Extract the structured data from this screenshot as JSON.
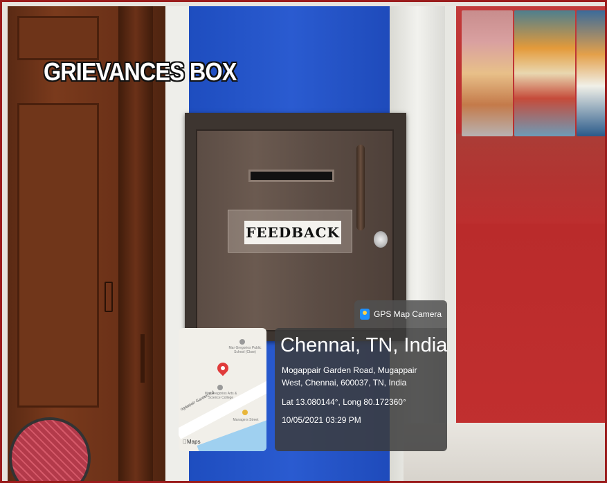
{
  "overlay_title": "GRIEVANCES BOX",
  "box_label": "FEEDBACK",
  "gps": {
    "app_name": "GPS Map Camera",
    "city": "Chennai, TN, India",
    "address": "Mogappair Garden Road, Mugappair West, Chennai, 600037, TN, India",
    "coordinates": "Lat 13.080144°, Long 80.172360°",
    "datetime": "10/05/2021 03:29 PM"
  },
  "map": {
    "place_1": "Mar Gregorios Public School (Cbse)",
    "place_2": "Mar Gregorios Arts & Science College",
    "place_3": "Managers Street",
    "road": "ogappair Garden Rd",
    "logo": "Maps"
  },
  "colors": {
    "frame_border": "#9b1c1c",
    "blue_wall": "#2a5bd0",
    "red_glass": "#b82a2a",
    "map_pin": "#e03b3b"
  }
}
